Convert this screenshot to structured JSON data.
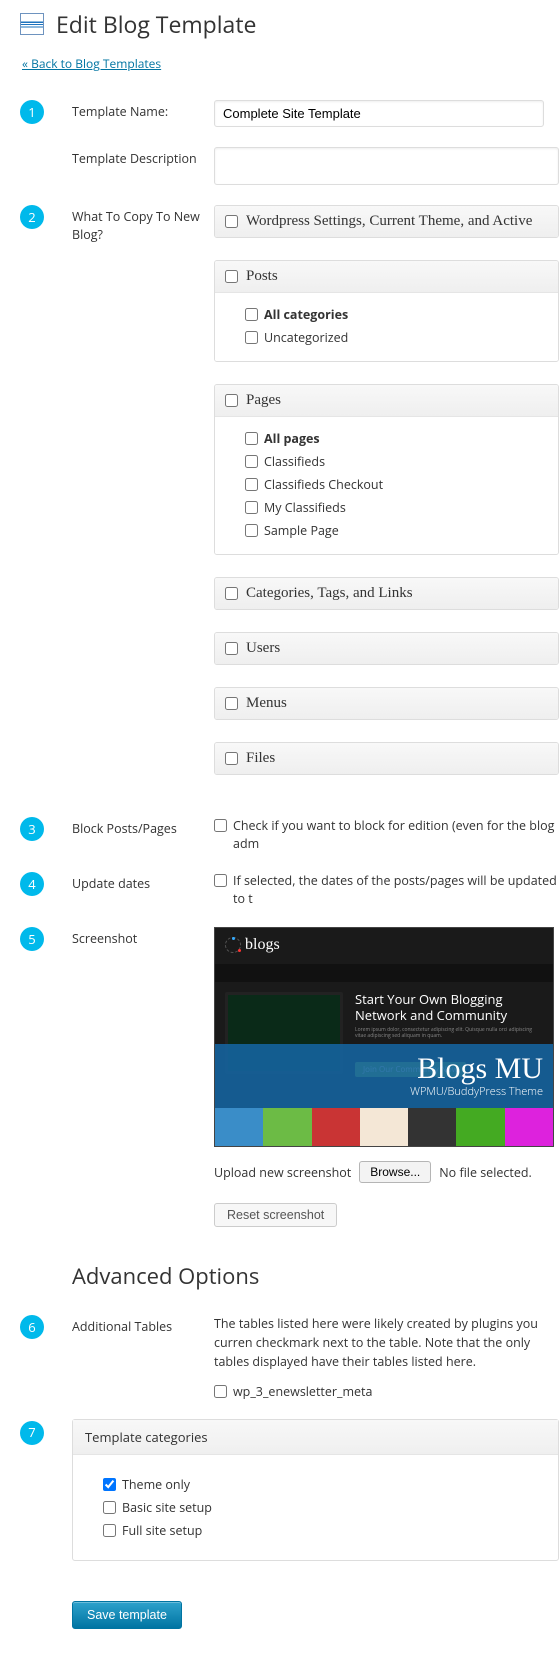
{
  "page_title": "Edit Blog Template",
  "back_link": "« Back to Blog Templates",
  "sections": {
    "s1": {
      "label": "Template Name:",
      "value": "Complete Site Template"
    },
    "s1b": {
      "label": "Template Description"
    },
    "s2": {
      "label": "What To Copy To New Blog?",
      "group_wp": "Wordpress Settings, Current Theme, and Active",
      "group_posts": {
        "title": "Posts",
        "items": [
          "All categories",
          "Uncategorized"
        ]
      },
      "group_pages": {
        "title": "Pages",
        "items": [
          "All pages",
          "Classifieds",
          "Classifieds Checkout",
          "My Classifieds",
          "Sample Page"
        ]
      },
      "group_cats": "Categories, Tags, and Links",
      "group_users": "Users",
      "group_menus": "Menus",
      "group_files": "Files"
    },
    "s3": {
      "label": "Block Posts/Pages",
      "check": "Check if you want to block for edition (even for the blog adm"
    },
    "s4": {
      "label": "Update dates",
      "check": "If selected, the dates of the posts/pages will be updated to t"
    },
    "s5": {
      "label": "Screenshot",
      "upload_label": "Upload new screenshot",
      "browse": "Browse...",
      "no_file": "No file selected.",
      "reset": "Reset screenshot",
      "ss_logo": "blogs",
      "ss_headline": "Start Your Own Blogging Network and Community",
      "ss_btn": "Join Our Community Now",
      "ss_brand": "Blogs MU",
      "ss_sub": "WPMU/BuddyPress Theme"
    }
  },
  "advanced_title": "Advanced Options",
  "s6": {
    "label": "Additional Tables",
    "text": "The tables listed here were likely created by plugins you curren checkmark next to the table. Note that the only tables displayed have their tables listed here.",
    "item": "wp_3_enewsletter_meta"
  },
  "s7": {
    "title": "Template categories",
    "items": [
      {
        "label": "Theme only",
        "checked": true
      },
      {
        "label": "Basic site setup",
        "checked": false
      },
      {
        "label": "Full site setup",
        "checked": false
      }
    ]
  },
  "save": "Save template"
}
